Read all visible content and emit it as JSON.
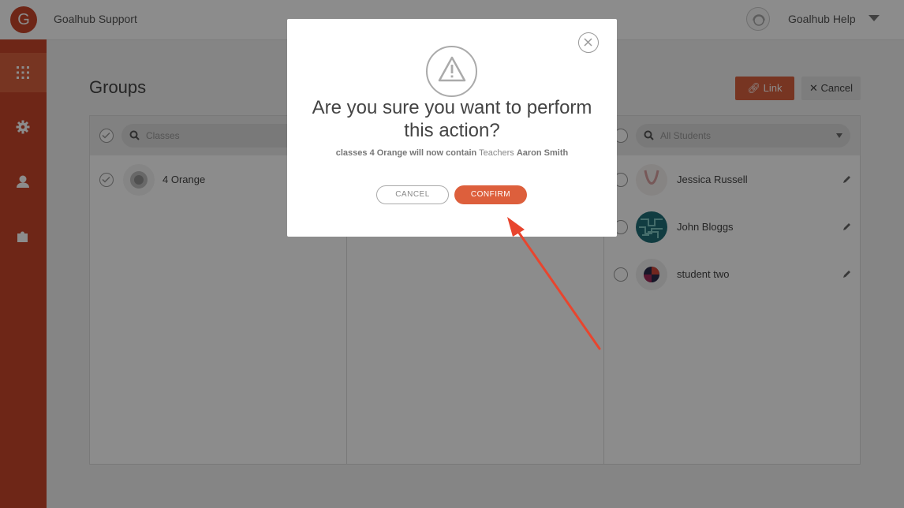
{
  "topbar": {
    "logo_letter": "G",
    "app_title": "Goalhub Support",
    "user_name": "Goalhub Help"
  },
  "sidebar": {
    "items": [
      {
        "icon": "grid-icon",
        "active": true
      },
      {
        "icon": "gear-icon",
        "active": false
      },
      {
        "icon": "user-icon",
        "active": false
      },
      {
        "icon": "puzzle-icon",
        "active": false
      }
    ]
  },
  "page": {
    "title": "Groups",
    "link_button": "Link",
    "cancel_button": "Cancel"
  },
  "classes_panel": {
    "search_placeholder": "Classes",
    "items": [
      {
        "name": "4 Orange"
      }
    ]
  },
  "students_panel": {
    "search_placeholder": "All Students",
    "items": [
      {
        "name": "Jessica Russell"
      },
      {
        "name": "John Bloggs"
      },
      {
        "name": "student two"
      }
    ]
  },
  "modal": {
    "title": "Are you sure you want to perform this action?",
    "message": {
      "part1": "classes 4 Orange will now contain",
      "part2": "Teachers",
      "part3": "Aaron Smith"
    },
    "cancel_label": "CANCEL",
    "confirm_label": "CONFIRM"
  },
  "colors": {
    "brand": "#c8452a",
    "accent": "#dd5f3c",
    "annotation_arrow": "#e8452e"
  }
}
